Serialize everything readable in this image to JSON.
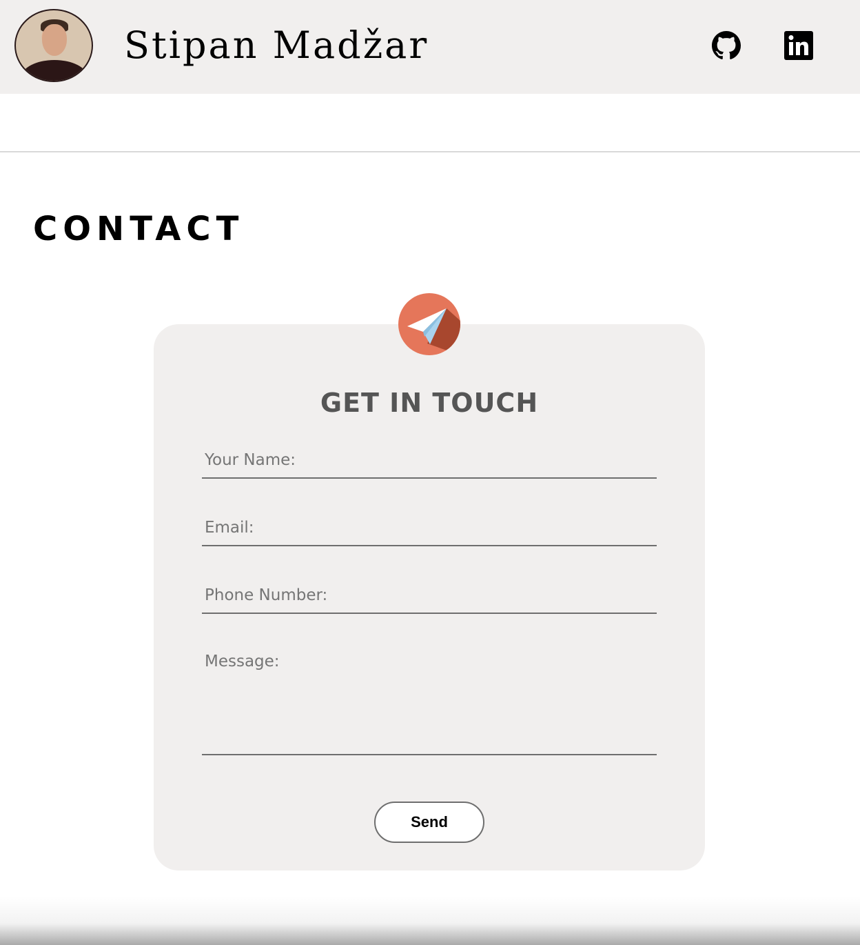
{
  "header": {
    "site_name": "Stipan Madžar",
    "avatar_icon": "profile-photo",
    "social_links": [
      {
        "name": "github-icon"
      },
      {
        "name": "linkedin-icon"
      }
    ]
  },
  "contact": {
    "section_title": "CONTACT",
    "card_icon": "paper-plane-icon",
    "card_title": "GET IN TOUCH",
    "fields": {
      "name_placeholder": "Your Name:",
      "email_placeholder": "Email:",
      "phone_placeholder": "Phone Number:",
      "message_placeholder": "Message:"
    },
    "send_label": "Send"
  },
  "colors": {
    "header_bg": "#f1efee",
    "card_bg": "#f1efee",
    "accent_orange": "#e5765a",
    "title_gray": "#555555"
  }
}
